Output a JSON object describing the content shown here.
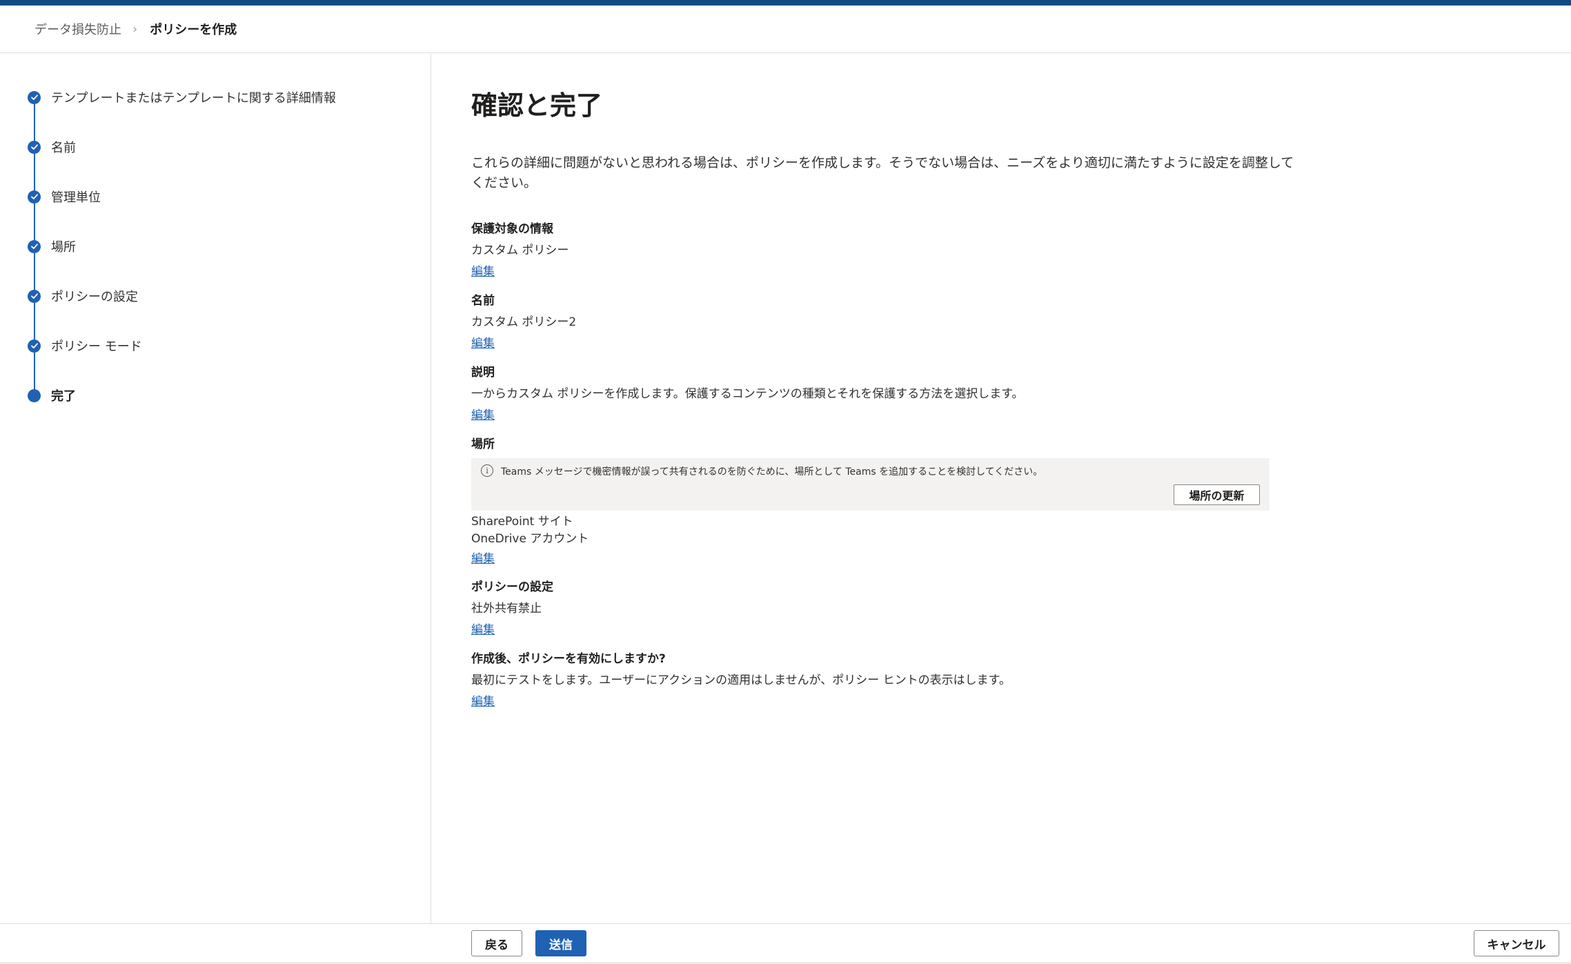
{
  "breadcrumb": {
    "parent": "データ損失防止",
    "separator": "›",
    "current": "ポリシーを作成"
  },
  "steps": [
    {
      "label": "テンプレートまたはテンプレートに関する詳細情報",
      "status": "complete"
    },
    {
      "label": "名前",
      "status": "complete"
    },
    {
      "label": "管理単位",
      "status": "complete"
    },
    {
      "label": "場所",
      "status": "complete"
    },
    {
      "label": "ポリシーの設定",
      "status": "complete"
    },
    {
      "label": "ポリシー モード",
      "status": "complete"
    },
    {
      "label": "完了",
      "status": "current"
    }
  ],
  "main": {
    "title": "確認と完了",
    "intro": "これらの詳細に問題がないと思われる場合は、ポリシーを作成します。そうでない場合は、ニーズをより適切に満たすように設定を調整してください。",
    "edit_label": "編集",
    "sections": {
      "protected_info": {
        "heading": "保護対象の情報",
        "value": "カスタム ポリシー"
      },
      "name": {
        "heading": "名前",
        "value": "カスタム ポリシー2"
      },
      "description": {
        "heading": "説明",
        "value": "一からカスタム ポリシーを作成します。保護するコンテンツの種類とそれを保護する方法を選択します。"
      },
      "locations": {
        "heading": "場所",
        "info_message": "Teams メッセージで機密情報が誤って共有されるのを防ぐために、場所として Teams を追加することを検討してください。",
        "update_button": "場所の更新",
        "values": [
          "SharePoint サイト",
          "OneDrive アカウント"
        ]
      },
      "policy_settings": {
        "heading": "ポリシーの設定",
        "value": "社外共有禁止"
      },
      "enable_policy": {
        "heading": "作成後、ポリシーを有効にしますか?",
        "value": "最初にテストをします。ユーザーにアクションの適用はしませんが、ポリシー ヒントの表示はします。"
      }
    }
  },
  "footer": {
    "back_label": "戻る",
    "submit_label": "送信",
    "cancel_label": "キャンセル"
  },
  "colors": {
    "accent": "#1f61b3",
    "top_bar": "#0f4c81",
    "info_background": "#f3f2f1"
  }
}
